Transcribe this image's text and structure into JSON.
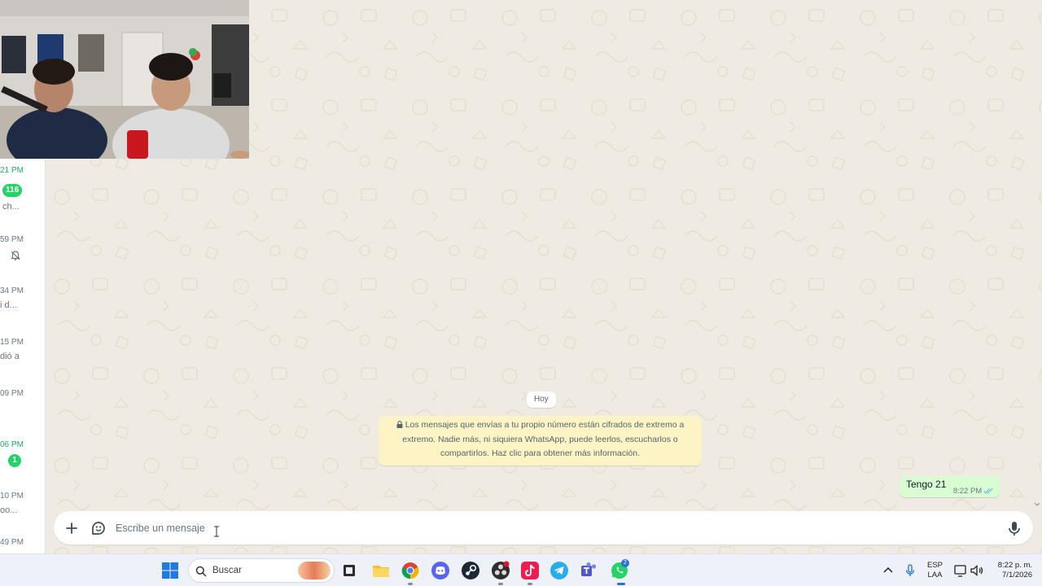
{
  "chat_list": {
    "rows": [
      {
        "time": "21 PM",
        "time_color": "#1daa61",
        "badge": "116",
        "snippet": "ch..."
      },
      {
        "time": "59 PM",
        "muted": true
      },
      {
        "time": "34 PM",
        "snippet": "i d..."
      },
      {
        "time": "15 PM",
        "snippet": "dió a"
      },
      {
        "time": "09 PM"
      },
      {
        "time": "06 PM",
        "time_color": "#1daa61",
        "badge": "1"
      },
      {
        "time": "10 PM",
        "snippet": "oo..."
      },
      {
        "time": "49 PM"
      }
    ]
  },
  "conversation": {
    "date_divider": "Hoy",
    "encryption_notice": "Los mensajes que envías a tu propio número están cifrados de extremo a extremo. Nadie más, ni siquiera WhatsApp, puede leerlos, escucharlos o compartirlos. Haz clic para obtener más información.",
    "messages": [
      {
        "text": "Tengo 21",
        "time": "8:22 PM",
        "direction": "outgoing",
        "status": "read"
      }
    ]
  },
  "composer": {
    "placeholder": "Escribe un mensaje",
    "attach_icon": "plus-icon",
    "sticker_icon": "sticker-icon",
    "mic_icon": "microphone-icon"
  },
  "taskbar": {
    "search_label": "Buscar",
    "apps": [
      "windows-start-icon",
      "file-explorer-icon",
      "chrome-icon",
      "discord-icon",
      "steam-icon",
      "obs-icon",
      "tiktok-icon",
      "telegram-icon",
      "teams-icon",
      "whatsapp-icon"
    ],
    "whatsapp_badge": "2",
    "language_line1": "ESP",
    "language_line2": "LAA",
    "clock_time": "8:22 p. m.",
    "clock_date": "7/1/2026"
  },
  "colors": {
    "accent_green": "#25d366",
    "outgoing_bubble": "#d9fdd3",
    "system_note": "#fdf4c5",
    "chat_bg": "#efeae2"
  }
}
